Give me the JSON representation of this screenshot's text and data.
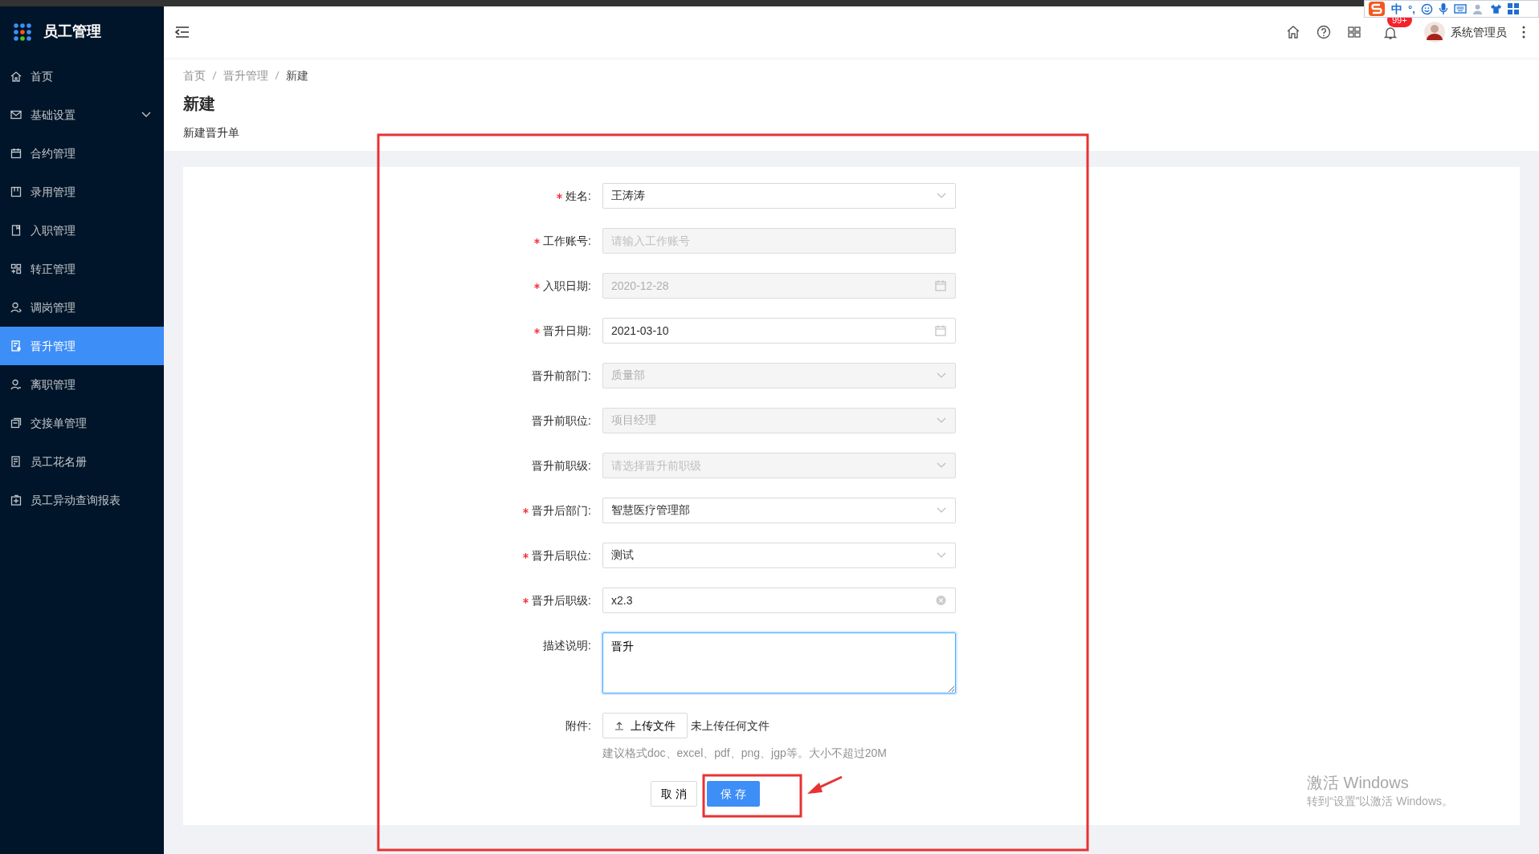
{
  "app": {
    "title": "员工管理"
  },
  "sidebar": {
    "items": [
      {
        "label": "首页",
        "kind": "item",
        "selected": false
      },
      {
        "label": "基础设置",
        "kind": "submenu",
        "expanded": false,
        "selected": false
      },
      {
        "label": "合约管理",
        "kind": "item",
        "selected": false
      },
      {
        "label": "录用管理",
        "kind": "item",
        "selected": false
      },
      {
        "label": "入职管理",
        "kind": "item",
        "selected": false
      },
      {
        "label": "转正管理",
        "kind": "item",
        "selected": false
      },
      {
        "label": "调岗管理",
        "kind": "item",
        "selected": false
      },
      {
        "label": "晋升管理",
        "kind": "item",
        "selected": true
      },
      {
        "label": "离职管理",
        "kind": "item",
        "selected": false
      },
      {
        "label": "交接单管理",
        "kind": "item",
        "selected": false
      },
      {
        "label": "员工花名册",
        "kind": "item",
        "selected": false
      },
      {
        "label": "员工异动查询报表",
        "kind": "item",
        "selected": false
      }
    ]
  },
  "header": {
    "notification_count": "99+",
    "user": "系统管理员"
  },
  "ime_bar": {
    "mode": "中",
    "punct": "°,"
  },
  "breadcrumb": [
    "首页",
    "晋升管理",
    "新建"
  ],
  "page_title": "新建",
  "page_subtitle": "新建晋升单",
  "form": {
    "fields": [
      {
        "label": "姓名:",
        "required": true,
        "kind": "select",
        "value": "王涛涛",
        "disabled": false
      },
      {
        "label": "工作账号:",
        "required": true,
        "kind": "input",
        "placeholder": "请输入工作账号",
        "disabled": true
      },
      {
        "label": "入职日期:",
        "required": true,
        "kind": "date",
        "value": "2020-12-28",
        "disabled": true
      },
      {
        "label": "晋升日期:",
        "required": true,
        "kind": "date",
        "value": "2021-03-10",
        "disabled": false
      },
      {
        "label": "晋升前部门:",
        "required": false,
        "kind": "select",
        "value": "质量部",
        "disabled": true
      },
      {
        "label": "晋升前职位:",
        "required": false,
        "kind": "select",
        "value": "项目经理",
        "disabled": true
      },
      {
        "label": "晋升前职级:",
        "required": false,
        "kind": "select",
        "placeholder": "请选择晋升前职级",
        "disabled": true
      },
      {
        "label": "晋升后部门:",
        "required": true,
        "kind": "select",
        "value": "智慧医疗管理部",
        "disabled": false
      },
      {
        "label": "晋升后职位:",
        "required": true,
        "kind": "select",
        "value": "测试",
        "disabled": false
      },
      {
        "label": "晋升后职级:",
        "required": true,
        "kind": "clearable",
        "value": "x2.3",
        "disabled": false
      },
      {
        "label": "描述说明:",
        "required": false,
        "kind": "textarea",
        "value": "晋升",
        "disabled": false,
        "focused": true
      }
    ],
    "attachment": {
      "label": "附件:",
      "button": "上传文件",
      "status": "未上传任何文件",
      "hint": "建议格式doc、excel、pdf、png、jgp等。大小不超过20M"
    },
    "buttons": [
      {
        "label": "取 消",
        "kind": "default"
      },
      {
        "label": "保 存",
        "kind": "primary"
      }
    ]
  },
  "annotations": [
    {
      "kind": "box"
    },
    {
      "kind": "box"
    },
    {
      "kind": "arrow"
    }
  ],
  "os_notice": {
    "title": "激活 Windows",
    "text": "转到“设置”以激活 Windows。"
  }
}
